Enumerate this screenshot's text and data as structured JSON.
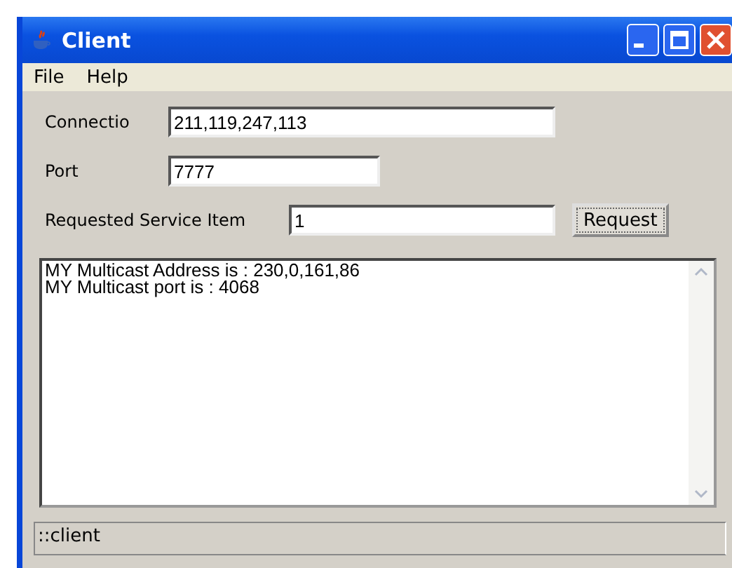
{
  "window": {
    "title": "Client"
  },
  "menu": [
    "File",
    "Help"
  ],
  "fields": [
    {
      "label": "Connectio",
      "value": "211,119,247,113"
    },
    {
      "label": "Port",
      "value": "7777"
    }
  ],
  "request": {
    "label": "Requested Service Item",
    "value": "1",
    "button": "Request"
  },
  "log": [
    "MY Multicast Address is : 230,0,161,86",
    "MY Multicast port is : 4068"
  ],
  "status_bar": "::client"
}
